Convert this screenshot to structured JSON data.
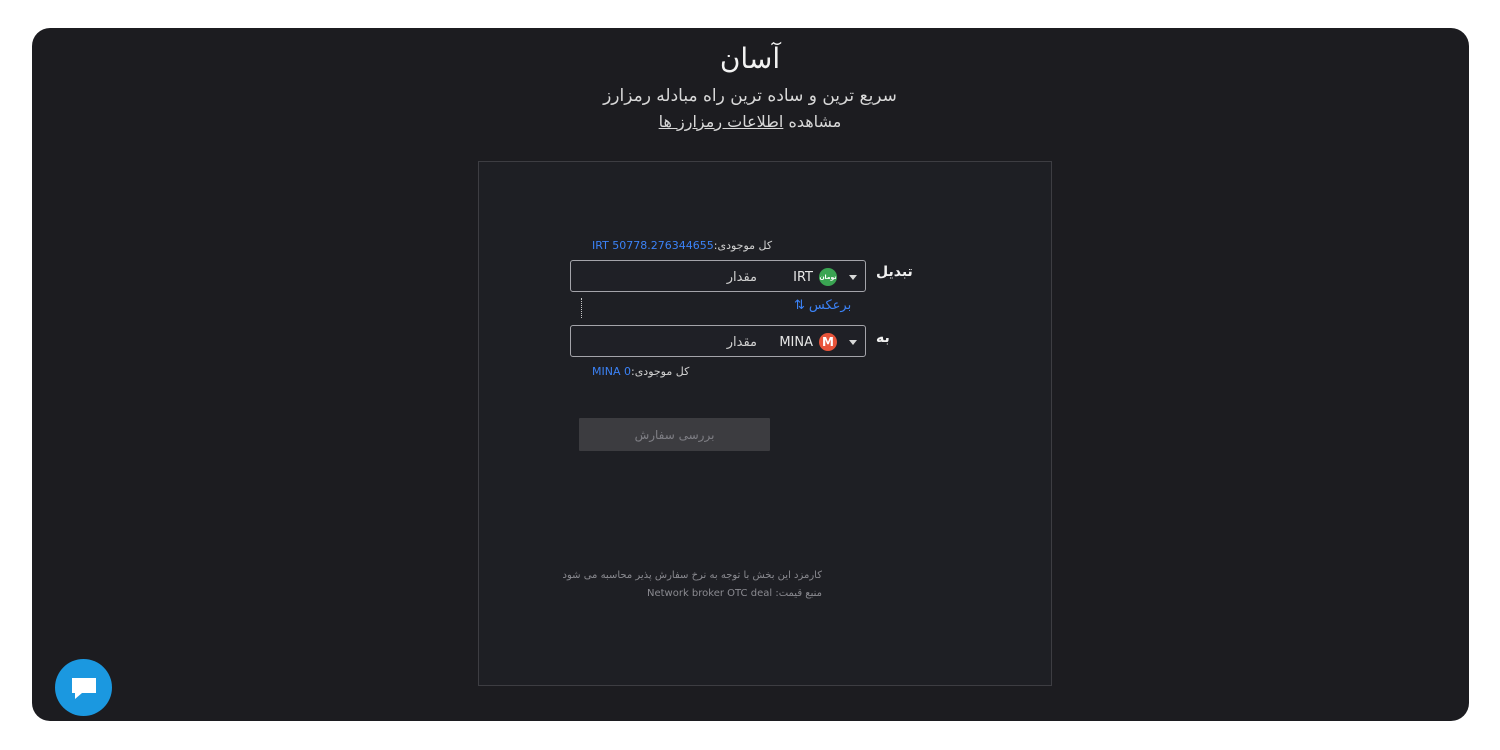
{
  "header": {
    "title": "آسان",
    "subtitle": "سریع ترین و ساده ترین راه مبادله رمزارز",
    "info_prefix": "مشاهده",
    "info_link": "اطلاعات رمزارز ها"
  },
  "convert": {
    "from_label": "تبدیل",
    "from_balance_label": "کل موجودی:",
    "from_balance_value": "IRT 50778.276344655",
    "from_currency": "IRT",
    "from_coin_text": "تومان",
    "from_placeholder": "مقدار",
    "reverse_label": "برعکس",
    "to_label": "به",
    "to_currency": "MINA",
    "to_coin_text": "M",
    "to_placeholder": "مقدار",
    "to_balance_label": "کل موجودی:",
    "to_balance_value": "MINA 0"
  },
  "actions": {
    "submit_label": "بررسی سفارش"
  },
  "notes": {
    "fee": "کارمزد این بخش با توجه به نرخ سفارش پذیر محاسبه می شود",
    "price_source_label": "منبع قیمت:",
    "price_source_value": "Network broker OTC deal"
  },
  "colors": {
    "background": "#1c1c20",
    "accent": "#3b82f6",
    "chat": "#1b98e0",
    "toman_coin": "#3aa452",
    "mina_coin": "#e8543a"
  }
}
